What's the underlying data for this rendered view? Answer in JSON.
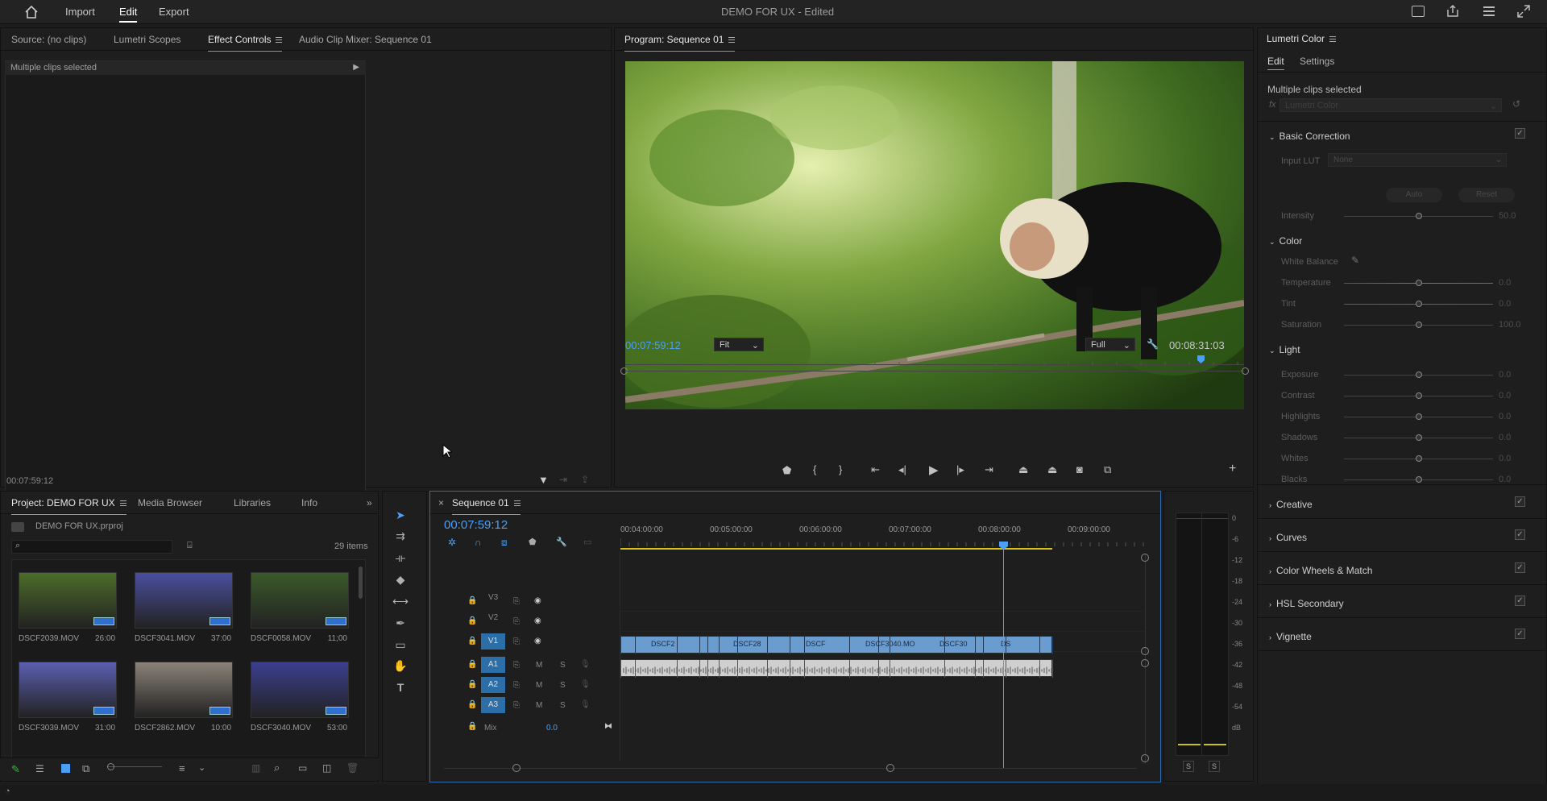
{
  "topbar": {
    "nav": [
      "Import",
      "Edit",
      "Export"
    ],
    "title": "DEMO FOR UX",
    "title_suffix": " - Edited"
  },
  "source_panel": {
    "tabs": [
      "Source: (no clips)",
      "Lumetri Scopes",
      "Effect Controls",
      "Audio Clip Mixer: Sequence 01"
    ],
    "header": "Multiple clips selected",
    "timecode": "00:07:59:12"
  },
  "program": {
    "title": "Program: Sequence 01",
    "timecode": "00:07:59:12",
    "fit": "Fit",
    "quality": "Full",
    "duration": "00:08:31:03"
  },
  "lumetri": {
    "title": "Lumetri Color",
    "tabs": [
      "Edit",
      "Settings"
    ],
    "selected": "Multiple clips selected",
    "fx_label": "fx",
    "effect": "Lumetri Color",
    "basic": {
      "label": "Basic Correction",
      "input_lut_label": "Input LUT",
      "input_lut": "None",
      "auto": "Auto",
      "reset": "Reset",
      "intensity_label": "Intensity",
      "intensity": "50.0"
    },
    "color": {
      "label": "Color",
      "white_balance": "White Balance",
      "rows": [
        {
          "label": "Temperature",
          "value": "0.0"
        },
        {
          "label": "Tint",
          "value": "0.0"
        },
        {
          "label": "Saturation",
          "value": "100.0"
        }
      ]
    },
    "light": {
      "label": "Light",
      "rows": [
        {
          "label": "Exposure",
          "value": "0.0"
        },
        {
          "label": "Contrast",
          "value": "0.0"
        },
        {
          "label": "Highlights",
          "value": "0.0"
        },
        {
          "label": "Shadows",
          "value": "0.0"
        },
        {
          "label": "Whites",
          "value": "0.0"
        },
        {
          "label": "Blacks",
          "value": "0.0"
        }
      ]
    },
    "sections": [
      "Creative",
      "Curves",
      "Color Wheels & Match",
      "HSL Secondary",
      "Vignette"
    ]
  },
  "project": {
    "tabs": [
      "Project: DEMO FOR UX",
      "Media Browser",
      "Libraries",
      "Info"
    ],
    "file": "DEMO FOR UX.prproj",
    "count": "29 items",
    "items": [
      {
        "name": "DSCF2039.MOV",
        "dur": "26:00",
        "color": "#4d6d2a"
      },
      {
        "name": "DSCF3041.MOV",
        "dur": "37:00",
        "color": "#4a4f9e"
      },
      {
        "name": "DSCF0058.MOV",
        "dur": "11;00",
        "color": "#3b5a2a"
      },
      {
        "name": "DSCF3039.MOV",
        "dur": "31:00",
        "color": "#5a5fb0"
      },
      {
        "name": "DSCF2862.MOV",
        "dur": "10:00",
        "color": "#8a8278"
      },
      {
        "name": "DSCF3040.MOV",
        "dur": "53:00",
        "color": "#3c3f8f"
      }
    ]
  },
  "timeline": {
    "title": "Sequence 01",
    "timecode": "00:07:59:12",
    "ruler": [
      "00:04:00:00",
      "00:05:00:00",
      "00:06:00:00",
      "00:07:00:00",
      "00:08:00:00",
      "00:09:00:00"
    ],
    "video_tracks": [
      "V3",
      "V2",
      "V1"
    ],
    "audio_tracks": [
      "A1",
      "A2",
      "A3"
    ],
    "mix_label": "Mix",
    "mix_value": "0.0",
    "m": "M",
    "s": "S",
    "clips": [
      "DSCF2",
      "DSCF28",
      "DSCF",
      "DSCF3040.MO",
      "DSCF30",
      "DS"
    ]
  },
  "meter": {
    "labels": [
      "0",
      "-6",
      "-12",
      "-18",
      "-24",
      "-30",
      "-36",
      "-42",
      "-48",
      "-54",
      "dB"
    ],
    "solo": "S"
  }
}
